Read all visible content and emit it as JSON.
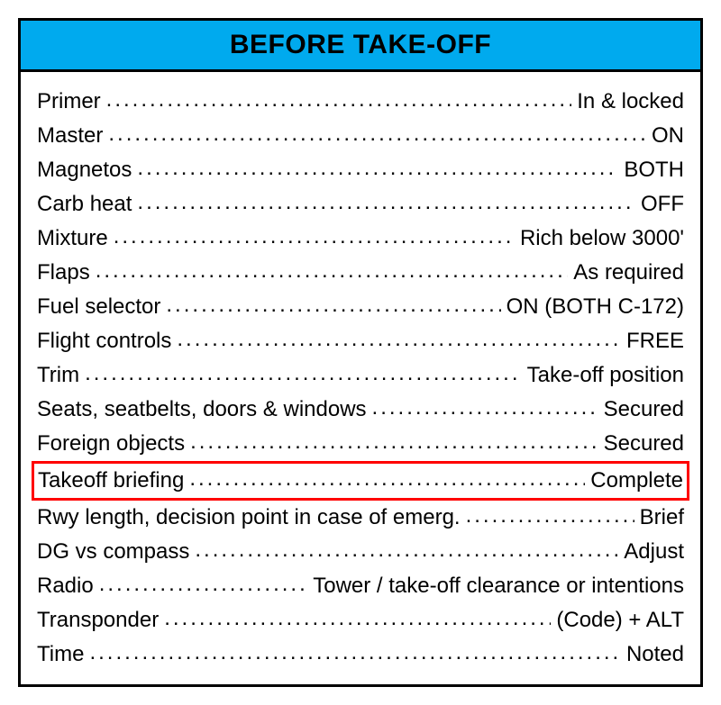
{
  "checklist": {
    "title": "BEFORE TAKE-OFF",
    "items": [
      {
        "label": "Primer",
        "value": "In & locked",
        "highlighted": false
      },
      {
        "label": "Master",
        "value": "ON",
        "highlighted": false
      },
      {
        "label": "Magnetos",
        "value": "BOTH",
        "highlighted": false
      },
      {
        "label": "Carb heat",
        "value": "OFF",
        "highlighted": false
      },
      {
        "label": "Mixture",
        "value": "Rich below 3000'",
        "highlighted": false
      },
      {
        "label": "Flaps",
        "value": "As required",
        "highlighted": false
      },
      {
        "label": "Fuel selector",
        "value": "ON (BOTH C-172)",
        "highlighted": false
      },
      {
        "label": "Flight controls",
        "value": "FREE",
        "highlighted": false
      },
      {
        "label": "Trim",
        "value": "Take-off position",
        "highlighted": false
      },
      {
        "label": "Seats, seatbelts, doors & windows",
        "value": "Secured",
        "highlighted": false
      },
      {
        "label": "Foreign objects",
        "value": "Secured",
        "highlighted": false
      },
      {
        "label": "Takeoff briefing",
        "value": "Complete",
        "highlighted": true
      },
      {
        "label": "Rwy length, decision point in case of emerg.",
        "value": "Brief",
        "highlighted": false
      },
      {
        "label": "DG vs compass",
        "value": "Adjust",
        "highlighted": false
      },
      {
        "label": "Radio",
        "value": "Tower / take-off clearance or intentions",
        "highlighted": false
      },
      {
        "label": "Transponder",
        "value": "(Code) + ALT",
        "highlighted": false
      },
      {
        "label": "Time",
        "value": "Noted",
        "highlighted": false
      }
    ]
  }
}
